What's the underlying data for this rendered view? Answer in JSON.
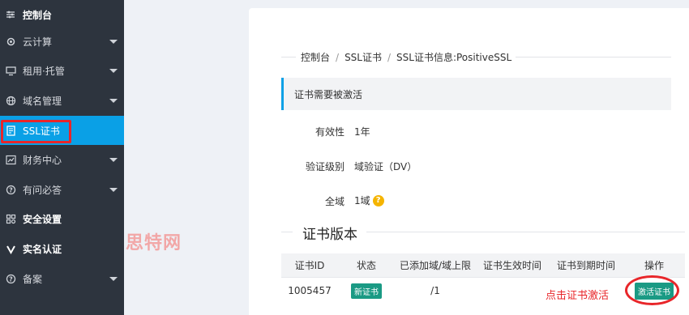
{
  "sidebar": {
    "items": [
      {
        "label": "控制台",
        "icon": "sliders-icon",
        "caret": false
      },
      {
        "label": "云计算",
        "icon": "cloud-gear-icon",
        "caret": true
      },
      {
        "label": "租用·托管",
        "icon": "monitor-icon",
        "caret": true
      },
      {
        "label": "域名管理",
        "icon": "globe-icon",
        "caret": true
      },
      {
        "label": "SSL证书",
        "icon": "certificate-icon",
        "caret": false,
        "active": true
      },
      {
        "label": "财务中心",
        "icon": "chart-icon",
        "caret": true
      },
      {
        "label": "有问必答",
        "icon": "question-circle-icon",
        "caret": true
      },
      {
        "label": "安全设置",
        "icon": "grid-icon",
        "caret": false
      },
      {
        "label": "实名认证",
        "icon": "v-icon",
        "caret": false
      },
      {
        "label": "备案",
        "icon": "question-circle-icon",
        "caret": true
      }
    ]
  },
  "watermark": "思特网",
  "breadcrumb": {
    "items": [
      "控制台",
      "SSL证书",
      "SSL证书信息:PositiveSSL"
    ],
    "separator": "/"
  },
  "notice": "证书需要被激活",
  "fields": {
    "validity_label": "有效性",
    "validity_value": "1年",
    "level_label": "验证级别",
    "level_value": "域验证（DV）",
    "domains_label": "全域",
    "domains_value": "1域",
    "help_glyph": "?"
  },
  "section_title": "证书版本",
  "table": {
    "headers": [
      "证书ID",
      "状态",
      "已添加域/域上限",
      "证书生效时间",
      "证书到期时间",
      "操作"
    ],
    "rows": [
      {
        "id": "1005457",
        "status": "新证书",
        "domains": "/1",
        "start": "",
        "end": "",
        "action": "激活证书"
      }
    ]
  },
  "annotation": "点击证书激活",
  "colors": {
    "sidebar_bg": "#2d343e",
    "accent": "#0aa0e6",
    "badge": "#1a9a84",
    "highlight": "#e8262a",
    "help": "#f5b400"
  }
}
